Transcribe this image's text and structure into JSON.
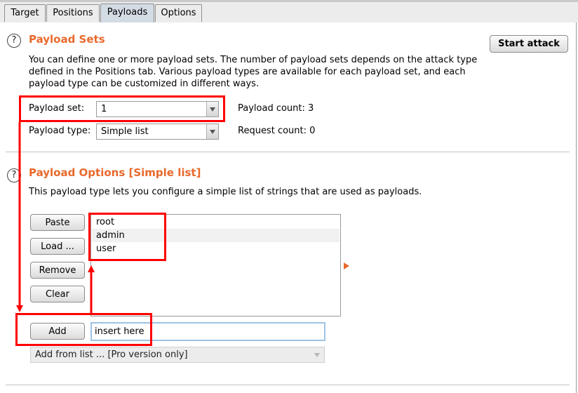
{
  "tabs": [
    {
      "label": "Target"
    },
    {
      "label": "Positions"
    },
    {
      "label": "Payloads",
      "active": true
    },
    {
      "label": "Options"
    }
  ],
  "payload_sets": {
    "help_glyph": "?",
    "title": "Payload Sets",
    "description": "You can define one or more payload sets. The number of payload sets depends on the attack type defined in the Positions tab. Various payload types are available for each payload set, and each payload type can be customized in different ways.",
    "start_attack_label": "Start attack",
    "payload_set_label": "Payload set:",
    "payload_set_value": "1",
    "payload_type_label": "Payload type:",
    "payload_type_value": "Simple list",
    "payload_count_label": "Payload count:",
    "payload_count_value": "3",
    "request_count_label": "Request count:",
    "request_count_value": "0"
  },
  "payload_options": {
    "help_glyph": "?",
    "title": "Payload Options [Simple list]",
    "description": "This payload type lets you configure a simple list of strings that are used as payloads.",
    "buttons": {
      "paste": "Paste",
      "load": "Load ...",
      "remove": "Remove",
      "clear": "Clear",
      "add": "Add"
    },
    "list_items": [
      "root",
      "admin",
      "user"
    ],
    "add_input_value": "insert here",
    "add_from_list_value": "Add from list ... [Pro version only]"
  },
  "colors": {
    "accent_orange": "#e8692c",
    "annotation_red": "#ff0000",
    "active_tab": "#d3dbe4"
  },
  "icons": {
    "help": "help-circle-icon",
    "dropdown": "chevron-down-icon",
    "expand": "triangle-right-icon"
  }
}
